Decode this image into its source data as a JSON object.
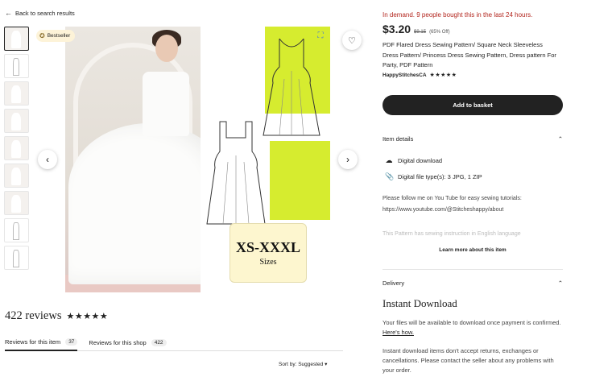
{
  "nav": {
    "back_label": "Back to search results",
    "back_icon": "arrow-left-icon"
  },
  "gallery": {
    "badge": "Bestseller",
    "size_banner_big": "XS-XXXL",
    "size_banner_small": "Sizes",
    "thumb_count": 10
  },
  "reviews": {
    "title": "422 reviews",
    "rating_stars": "★★★★★",
    "tabs": [
      {
        "label": "Reviews for this item",
        "count": "37"
      },
      {
        "label": "Reviews for this shop",
        "count": "422"
      }
    ],
    "sort_label": "Sort by: Suggested"
  },
  "product": {
    "demand": "In demand. 9 people bought this in the last 24 hours.",
    "price": "$3.20",
    "original_price": "$9.15",
    "discount": "(65% Off)",
    "title": "PDF Flared Dress Sewing Pattern/ Square Neck Sleeveless Dress Pattern/ Princess Dress Sewing Pattern, Dress pattern For Party, PDF Pattern",
    "shop_name": "HappyStitchesCA",
    "shop_stars": "★★★★★",
    "add_button": "Add to basket"
  },
  "item_details": {
    "heading": "Item details",
    "rows": [
      "Digital download",
      "Digital file type(s): 3 JPG, 1 ZIP"
    ],
    "desc1": "Please follow me on You Tube for easy sewing tutorials: https://www.youtube.com/@Stitcheshappy/about",
    "desc_faded": "This Pattern has sewing instruction in English language",
    "learn_more": "Learn more about this item"
  },
  "delivery": {
    "heading": "Delivery",
    "instant_title": "Instant Download",
    "para1": "Your files will be available to download once payment is confirmed.",
    "para1_link": "Here's how.",
    "para2": "Instant download items don't accept returns, exchanges or cancellations. Please contact the seller about any problems with your order."
  },
  "colors": {
    "accent_red": "#b3261e",
    "lime": "#d6ec2f",
    "dark": "#222222"
  }
}
